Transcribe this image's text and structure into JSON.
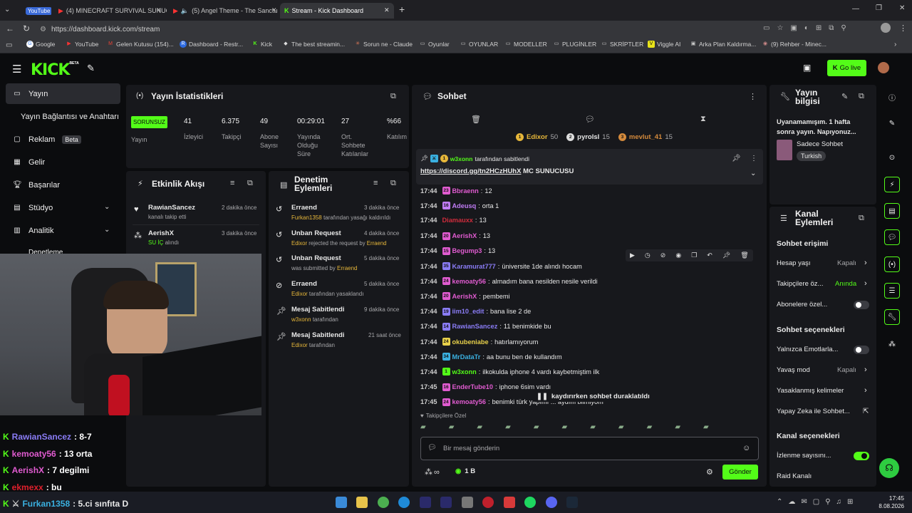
{
  "browser": {
    "tabs": [
      {
        "label": "YouTube",
        "pill": true
      },
      {
        "label": "(4) MINECRAFT SURVIVAL SUNUCUS"
      },
      {
        "label": "(5) Angel Theme - The Sanctu"
      },
      {
        "label": "Stream - Kick Dashboard"
      }
    ],
    "url": "https://dashboard.kick.com/stream",
    "bookmarks": [
      "Google",
      "YouTube",
      "Gelen Kutusu (154)...",
      "Dashboard - Restr...",
      "Kick",
      "The best streamin...",
      "Sorun ne - Claude",
      "Oyunlar",
      "OYUNLAR",
      "MODELLER",
      "PLUGİNLER",
      "SKRİPTLER",
      "Viggle AI",
      "Arka Plan Kaldırma...",
      "(9) Rehber - Minec..."
    ]
  },
  "header": {
    "logo": "KICK",
    "logo_sup": "BETA",
    "go_live": "Go live",
    "colors": {
      "brand": "#53fc18"
    }
  },
  "sidebar": {
    "items": [
      {
        "label": "Yayın"
      },
      {
        "label": "Yayın Bağlantısı ve Anahtarı"
      },
      {
        "label": "Reklam",
        "badge": "Beta"
      },
      {
        "label": "Gelir"
      },
      {
        "label": "Başarılar"
      },
      {
        "label": "Stüdyo"
      },
      {
        "label": "Analitik"
      },
      {
        "label": "Denetleme"
      }
    ]
  },
  "stats": {
    "title": "Yayın İstatistikleri",
    "status": "SORUNSUZ",
    "status_label": "Yayın",
    "items": [
      {
        "value": "41",
        "label": "İzleyici"
      },
      {
        "value": "6.375",
        "label": "Takipçi"
      },
      {
        "value": "49",
        "label": "Abone Sayısı"
      },
      {
        "value": "00:29:01",
        "label": "Yayında Olduğu Süre"
      },
      {
        "value": "27",
        "label": "Ort. Sohbete Katılanlar"
      },
      {
        "value": "%66",
        "label": "Katılım"
      }
    ]
  },
  "activity": {
    "title": "Etkinlik Akışı",
    "items": [
      {
        "user": "RawianSancez",
        "desc": "kanalı takip etti",
        "time": "2 dakika önce"
      },
      {
        "user": "AerishX",
        "desc": "SU İÇ",
        "desc2": "alındı",
        "time": "3 dakika önce"
      }
    ]
  },
  "moderation": {
    "title": "Denetim Eylemleri",
    "items": [
      {
        "title": "Erraend",
        "time": "3 dakika önce",
        "actor": "Furkan1358",
        "desc": "tarafından yasağı kaldırıldı"
      },
      {
        "title": "Unban Request",
        "time": "4 dakika önce",
        "actor": "Edixor",
        "desc": "rejected the request by",
        "target": "Erraend"
      },
      {
        "title": "Unban Request",
        "time": "5 dakika önce",
        "actor": "",
        "desc": "was submitted by",
        "target": "Erraend"
      },
      {
        "title": "Erraend",
        "time": "5 dakika önce",
        "actor": "Edixor",
        "desc": "tarafından yasaklandı"
      },
      {
        "title": "Mesaj Sabitlendi",
        "time": "9 dakika önce",
        "actor": "w3xonn",
        "desc": "tarafından"
      },
      {
        "title": "Mesaj Sabitlendi",
        "time": "21 saat önce",
        "actor": "Edixor",
        "desc": "tarafından"
      }
    ]
  },
  "chat": {
    "title": "Sohbet",
    "leaderboard": [
      {
        "name": "Edixor",
        "value": "50"
      },
      {
        "name": "pyrolsl",
        "value": "15"
      },
      {
        "name": "mevlut_41",
        "value": "15"
      }
    ],
    "pinned": {
      "by": "w3xonn",
      "by_suffix": "tarafından sabitlendi",
      "link": "https://discord.gg/tn2HCzHUhX",
      "text": "MC SUNUCUSU"
    },
    "messages": [
      {
        "time": "17:44",
        "badge": "23",
        "user": "Bbraenn",
        "color": "#e05bd0",
        "text": "12"
      },
      {
        "time": "17:44",
        "badge": "16",
        "user": "Adeusq",
        "color": "#c07cf5",
        "text": "orta 1"
      },
      {
        "time": "17:44",
        "badge": "",
        "user": "Diamauxx",
        "color": "#d02c3c",
        "text": "13"
      },
      {
        "time": "17:44",
        "badge": "20",
        "user": "AerishX",
        "color": "#e05bd0",
        "text": "13"
      },
      {
        "time": "17:44",
        "badge": "15",
        "user": "Begump3",
        "color": "#e05bd0",
        "text": "13"
      },
      {
        "time": "17:44",
        "badge": "35",
        "user": "Karamurat777",
        "color": "#8a7cf5",
        "text": "üniversite 1de alındı hocam"
      },
      {
        "time": "17:44",
        "badge": "24",
        "user": "kemoaty56",
        "color": "#e05bd0",
        "text": "almadım bana nesilden nesile verildi"
      },
      {
        "time": "17:44",
        "badge": "20",
        "user": "AerishX",
        "color": "#e05bd0",
        "text": "pembemi"
      },
      {
        "time": "17:44",
        "badge": "19",
        "user": "iim10_edit",
        "color": "#8a7cf5",
        "text": "bana lise 2 de"
      },
      {
        "time": "17:44",
        "badge": "14",
        "user": "RawianSancez",
        "color": "#8a7cf5",
        "text": "11 benimkide bu"
      },
      {
        "time": "17:44",
        "badge": "24",
        "user": "okubeniabe",
        "color": "#e7d04a",
        "text": "hatırlamıyorum"
      },
      {
        "time": "17:44",
        "badge": "34",
        "user": "MrDataTr",
        "color": "#3ab0e0",
        "text": "aa bunu ben de kullandım"
      },
      {
        "time": "17:44",
        "badge": "1",
        "user": "w3xonn",
        "color": "#53fc18",
        "text": "ilkokulda iphone 4 vardı kaybetmiştim ilk"
      },
      {
        "time": "17:45",
        "badge": "16",
        "user": "EnderTube10",
        "color": "#e05bd0",
        "text": "iphone 6sim vardı"
      },
      {
        "time": "17:45",
        "badge": "24",
        "user": "kemoaty56",
        "color": "#e05bd0",
        "text": "benimki türk yapımı ... aydım bilmiyom"
      }
    ],
    "paused": "kaydırırken sohbet duraklatıldı",
    "followers_only": "Takipçilere Özel",
    "input_placeholder": "Bir mesaj gönderin",
    "points": "1 B",
    "send": "Gönder"
  },
  "stream_info": {
    "title": "Yayın bilgisi",
    "stream_title": "Uyanamamışım. 1 hafta sonra yayın. Napıyonuz...",
    "category": "Sadece Sohbet",
    "tag": "Turkish"
  },
  "channel_actions": {
    "title": "Kanal Eylemleri",
    "chat_access": "Sohbet erişimi",
    "account_age": {
      "label": "Hesap yaşı",
      "value": "Kapalı"
    },
    "followers_only": {
      "label": "Takipçilere öz...",
      "value": "Anında"
    },
    "subscribers_only": {
      "label": "Abonelere özel..."
    },
    "chat_options": "Sohbet seçenekleri",
    "emotes_only": {
      "label": "Yalnızca Emotlarla..."
    },
    "slow_mode": {
      "label": "Yavaş mod",
      "value": "Kapalı"
    },
    "banned_words": {
      "label": "Yasaklanmış kelimeler"
    },
    "ai_chat": {
      "label": "Yapay Zeka ile Sohbet..."
    },
    "channel_options": "Kanal seçenekleri",
    "viewer_count": {
      "label": "İzlenme sayısını..."
    },
    "raid": {
      "label": "Raid Kanalı"
    }
  },
  "overlay_chat": [
    {
      "user": "RawianSancez",
      "color": "#8a7cf5",
      "text": ": 8-7"
    },
    {
      "user": "kemoaty56",
      "color": "#e05bd0",
      "text": ": 13 orta"
    },
    {
      "user": "AerishX",
      "color": "#e05bd0",
      "text": ": 7 degilmi"
    },
    {
      "user": "ekmexx",
      "color": "#e0202c",
      "text": ": bu"
    },
    {
      "user": "Furkan1358",
      "color": "#3ab0e0",
      "text": ": 5.ci sınfıta D"
    }
  ],
  "taskbar": {
    "time": "17:45",
    "date": "8.08.2026"
  }
}
